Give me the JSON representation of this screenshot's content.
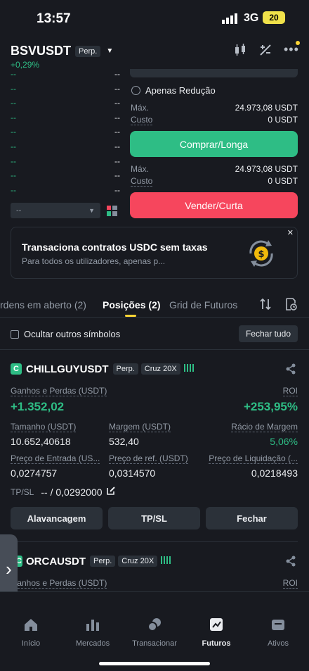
{
  "status_bar": {
    "time": "13:57",
    "network": "3G",
    "battery": "20"
  },
  "header": {
    "symbol": "BSVUSDT",
    "contract_type": "Perp.",
    "change": "+0,29%"
  },
  "orderbook": {
    "placeholder": "--",
    "depth_select": "--",
    "rows": 9
  },
  "order_form": {
    "reduce_only_label": "Apenas Redução",
    "buy": {
      "max_label": "Máx.",
      "max_value": "24.973,08 USDT",
      "cost_label": "Custo",
      "cost_value": "0 USDT",
      "button": "Comprar/Longa"
    },
    "sell": {
      "max_label": "Máx.",
      "max_value": "24.973,08 USDT",
      "cost_label": "Custo",
      "cost_value": "0 USDT",
      "button": "Vender/Curta"
    }
  },
  "promo": {
    "title": "Transaciona contratos USDC sem taxas",
    "subtitle": "Para todos os utilizadores, apenas p..."
  },
  "tabs": [
    {
      "label": "rdens em aberto (2)"
    },
    {
      "label": "Posições (2)"
    },
    {
      "label": "Grid de Futuros"
    }
  ],
  "filter": {
    "hide_others": "Ocultar outros símbolos",
    "close_all": "Fechar tudo"
  },
  "positions": [
    {
      "badge": "C",
      "symbol": "CHILLGUYUSDT",
      "contract_type": "Perp.",
      "margin_mode": "Cruz 20X",
      "pnl_label": "Ganhos e Perdas (USDT)",
      "pnl_value": "+1.352,02",
      "roi_label": "ROI",
      "roi_value": "+253,95%",
      "size_label": "Tamanho (USDT)",
      "size_value": "10.652,40618",
      "margin_label": "Margem (USDT)",
      "margin_value": "532,40",
      "margin_ratio_label": "Rácio de Margem",
      "margin_ratio_value": "5,06%",
      "entry_label": "Preço de Entrada (US...",
      "entry_value": "0,0274757",
      "mark_label": "Preço de ref. (USDT)",
      "mark_value": "0,0314570",
      "liq_label": "Preço de Liquidação (...",
      "liq_value": "0,0218493",
      "tpsl_label": "TP/SL",
      "tpsl_value": "-- / 0,0292000",
      "actions": [
        "Alavancagem",
        "TP/SL",
        "Fechar"
      ]
    },
    {
      "badge": "C",
      "symbol": "ORCAUSDT",
      "contract_type": "Perp.",
      "margin_mode": "Cruz 20X",
      "pnl_label": "Ganhos e Perdas (USDT)",
      "roi_label": "ROI"
    }
  ],
  "bottom_nav": [
    {
      "label": "Início",
      "icon": "home-icon"
    },
    {
      "label": "Mercados",
      "icon": "markets-icon"
    },
    {
      "label": "Transacionar",
      "icon": "trade-icon"
    },
    {
      "label": "Futuros",
      "icon": "futures-icon"
    },
    {
      "label": "Ativos",
      "icon": "wallet-icon"
    }
  ],
  "colors": {
    "background": "#181a20",
    "buy": "#2ebd85",
    "sell": "#f6465d",
    "accent": "#fcd535"
  }
}
